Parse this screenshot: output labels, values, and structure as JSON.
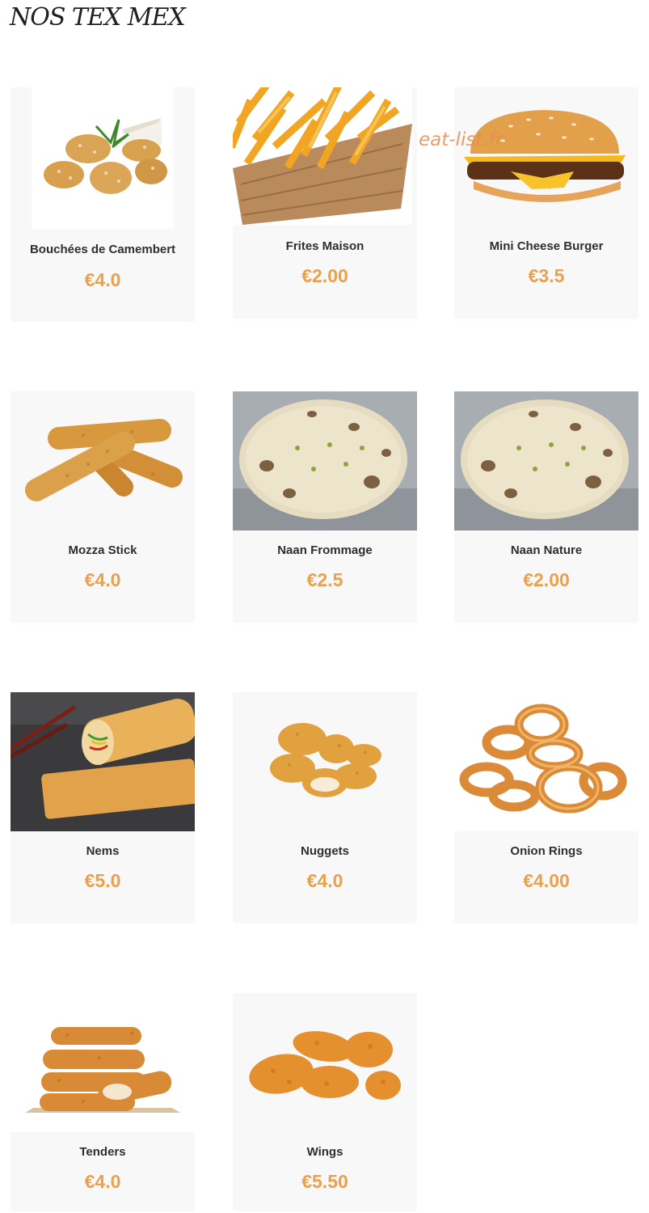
{
  "page": {
    "title": "NOS TEX MEX",
    "watermark": "eat-list.fr"
  },
  "colors": {
    "price": "#eba04c",
    "card_bg": "#f8f8f8",
    "title": "#1f1f1f",
    "text": "#2f2f2f"
  },
  "products": [
    {
      "name": "Bouchées de Camembert",
      "price": "€4.0",
      "image": "camembert-bites-photo"
    },
    {
      "name": "Frites Maison",
      "price": "€2.00",
      "image": "fries-basket-photo"
    },
    {
      "name": "Mini Cheese Burger",
      "price": "€3.5",
      "image": "cheeseburger-photo"
    },
    {
      "name": "Mozza Stick",
      "price": "€4.0",
      "image": "mozzarella-sticks-photo"
    },
    {
      "name": "Naan Frommage",
      "price": "€2.5",
      "image": "naan-bread-photo"
    },
    {
      "name": "Naan Nature",
      "price": "€2.00",
      "image": "naan-bread-photo"
    },
    {
      "name": "Nems",
      "price": "€5.0",
      "image": "spring-rolls-photo"
    },
    {
      "name": "Nuggets",
      "price": "€4.0",
      "image": "chicken-nuggets-photo"
    },
    {
      "name": "Onion Rings",
      "price": "€4.00",
      "image": "onion-rings-photo"
    },
    {
      "name": "Tenders",
      "price": "€4.0",
      "image": "chicken-tenders-photo"
    },
    {
      "name": "Wings",
      "price": "€5.50",
      "image": "chicken-wings-photo"
    }
  ]
}
